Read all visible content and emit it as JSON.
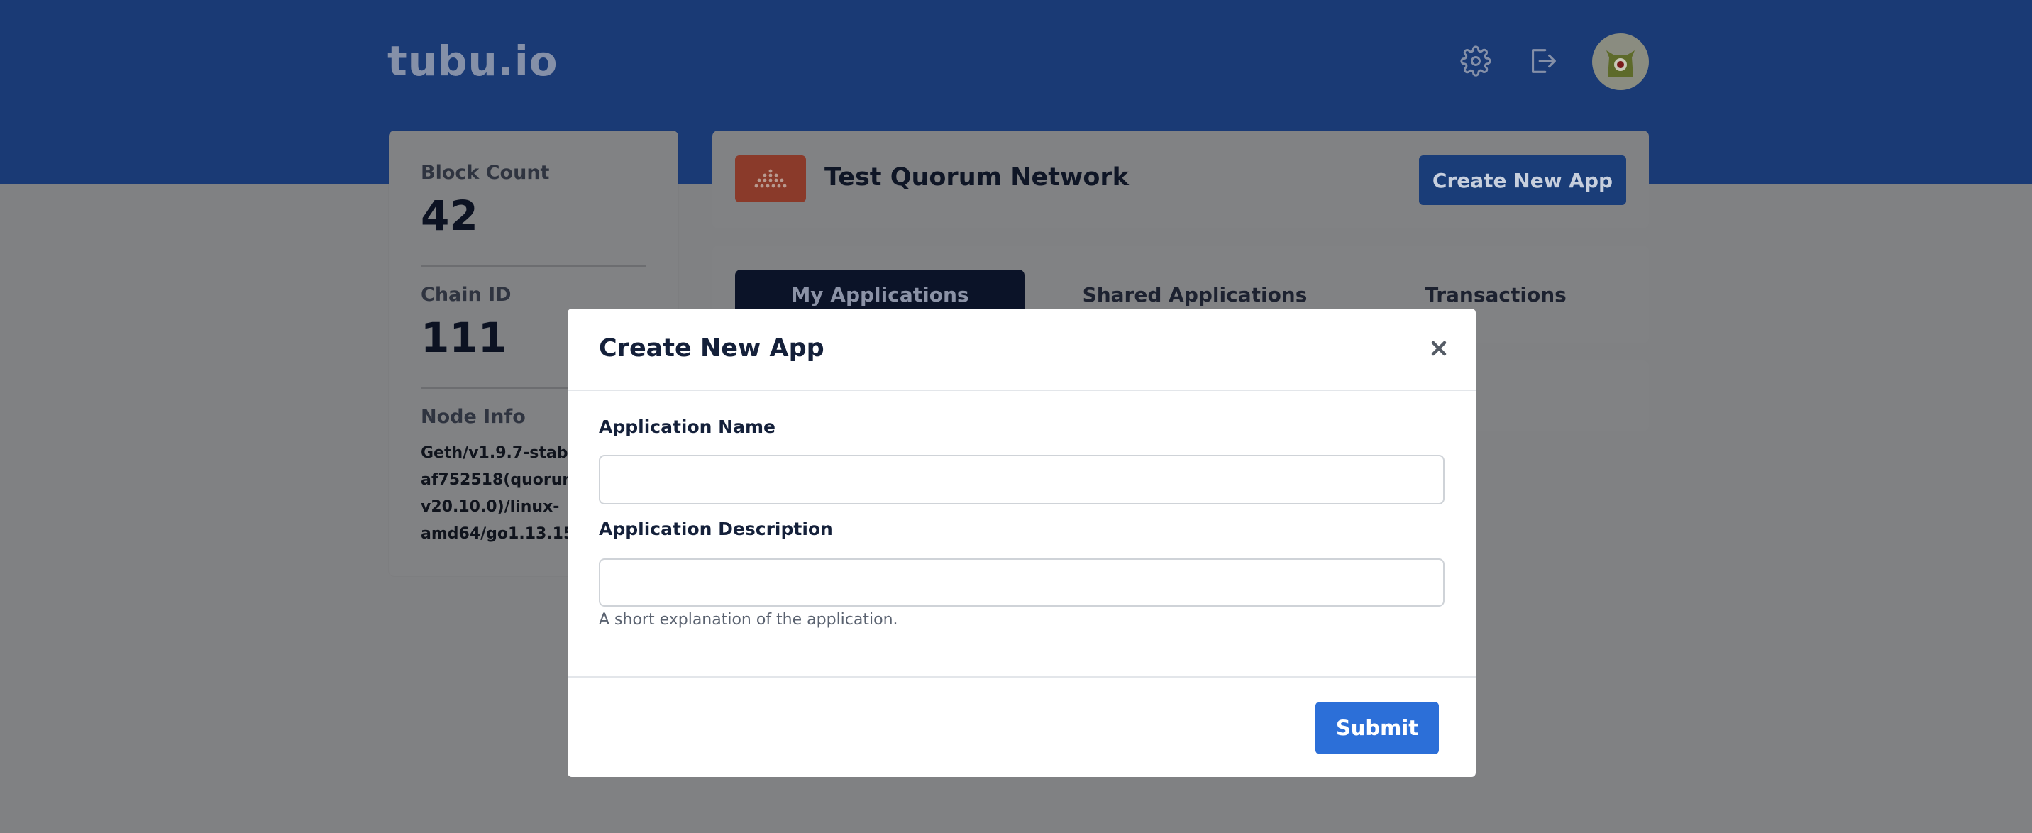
{
  "header": {
    "logo_text": "tubu.io",
    "icons": [
      "gear-icon",
      "logout-icon",
      "avatar"
    ]
  },
  "stats": {
    "block_count_label": "Block Count",
    "block_count_value": "42",
    "chain_id_label": "Chain ID",
    "chain_id_value": "111",
    "node_info_label": "Node Info",
    "node_info_value": "Geth/v1.9.7-stable-af752518(quorum-v20.10.0)/linux-amd64/go1.13.15"
  },
  "network": {
    "title": "Test Quorum Network",
    "create_app_label": "Create New App"
  },
  "tabs": [
    {
      "label": "My Applications",
      "active": true
    },
    {
      "label": "Shared Applications",
      "active": false
    },
    {
      "label": "Transactions",
      "active": false
    }
  ],
  "modal": {
    "title": "Create New App",
    "close_icon": "close-icon",
    "app_name_label": "Application Name",
    "app_name_value": "",
    "app_desc_label": "Application Description",
    "app_desc_value": "",
    "app_desc_help": "A short explanation of the application.",
    "submit_label": "Submit"
  },
  "colors": {
    "header_blue": "#1a3a75",
    "primary_button": "#2c6fd8",
    "overlay_gray": "#808183",
    "network_logo": "#8a3a2a"
  }
}
